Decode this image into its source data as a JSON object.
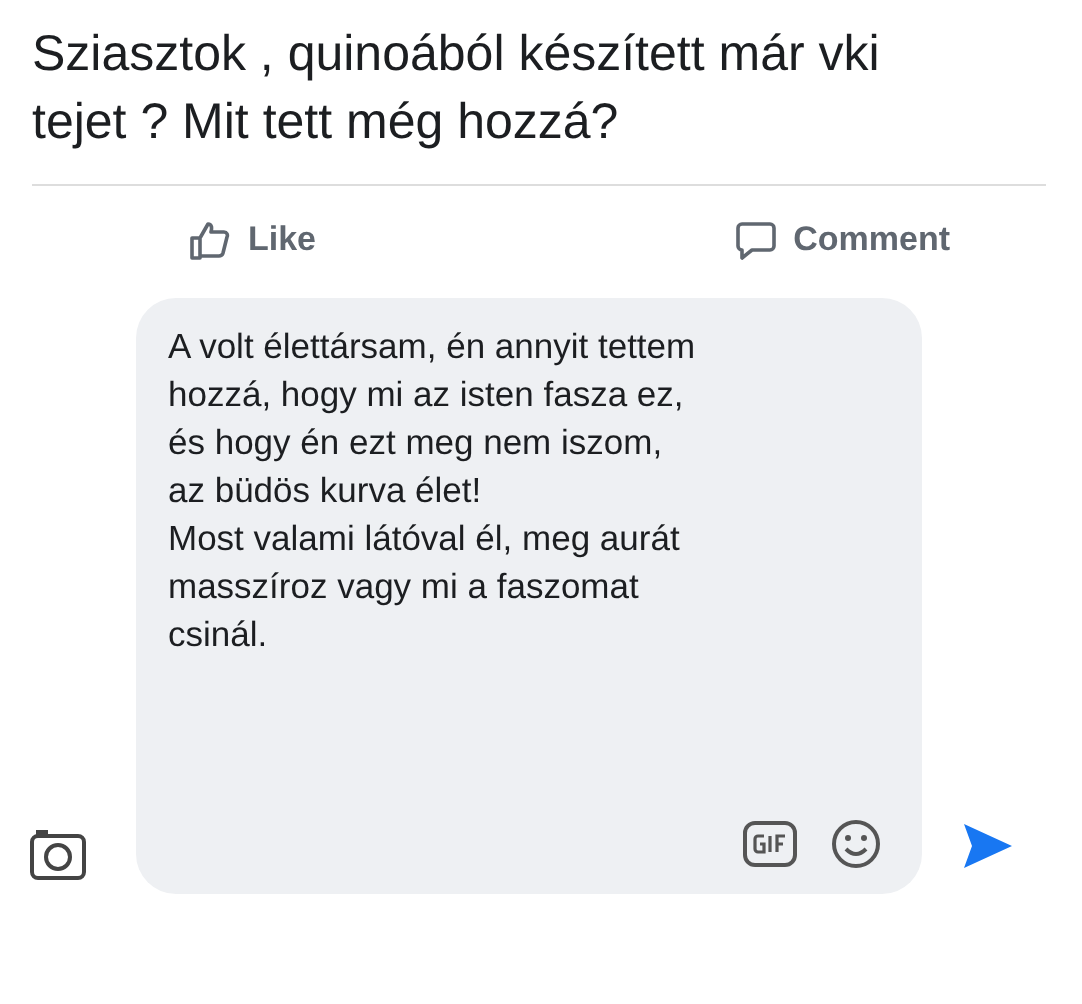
{
  "post": {
    "text": "Sziasztok , quinoából készített már vki tejet ? Mit tett még hozzá?"
  },
  "actions": [
    {
      "kind": "like",
      "label": "Like"
    },
    {
      "kind": "comment",
      "label": "Comment"
    }
  ],
  "comment_box": {
    "paragraphs": [
      "A volt élettársam, én annyit tettem hozzá, hogy mi az isten fasza ez, és hogy én ezt meg nem iszom, az büdös kurva élet!",
      "Most valami látóval él, meg aurát masszíroz vagy mi a faszomat csinál."
    ]
  }
}
